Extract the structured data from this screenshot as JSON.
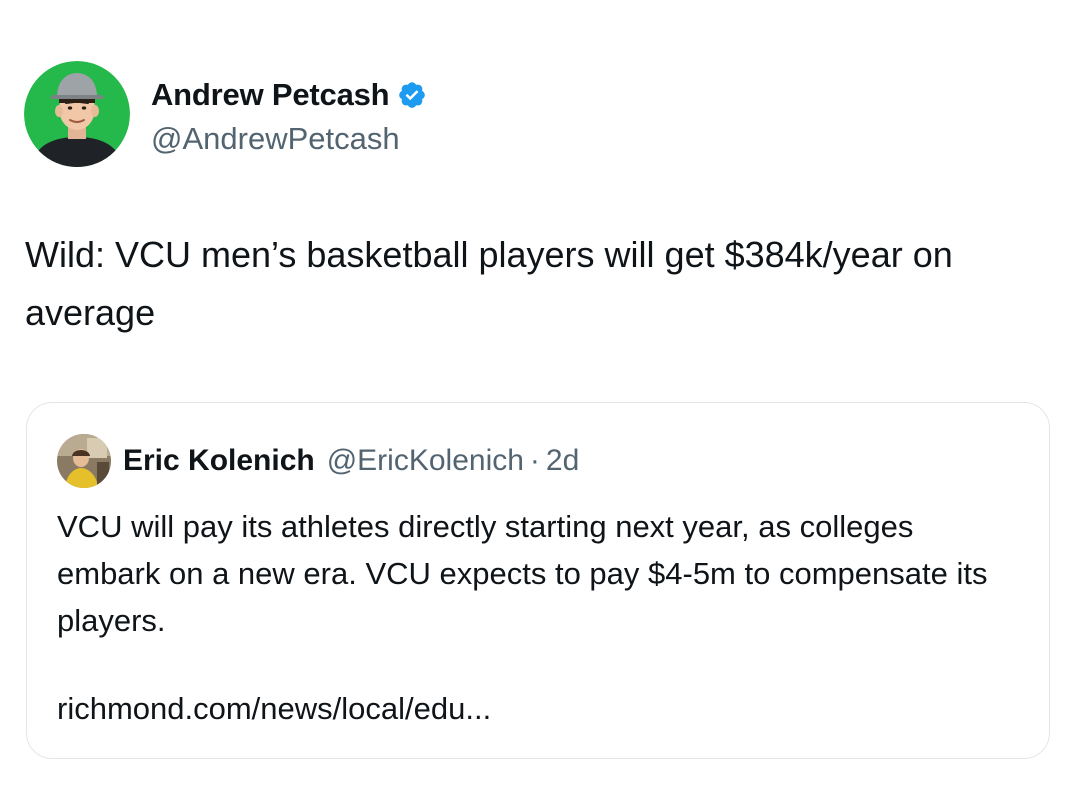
{
  "author": {
    "name": "Andrew Petcash",
    "handle": "@AndrewPetcash",
    "verified": true,
    "avatar_icon": "profile-photo-cartoon-man-cap-green-bg"
  },
  "tweet": {
    "text": "Wild: VCU men’s basketball players will get $384k/year on average"
  },
  "quote": {
    "name": "Eric Kolenich",
    "handle": "@EricKolenich",
    "separator": "·",
    "time": "2d",
    "avatar_icon": "profile-photo",
    "text": "VCU will pay its athletes directly starting next year, as colleges embark on a new era. VCU expects to pay $4-5m to compensate its players.",
    "link": "richmond.com/news/local/edu..."
  },
  "colors": {
    "primary_text": "#0f1419",
    "secondary_text": "#536471",
    "verified_blue": "#1d9bf0",
    "card_border": "#e3e6e9",
    "avatar_bg": "#25b84a"
  }
}
